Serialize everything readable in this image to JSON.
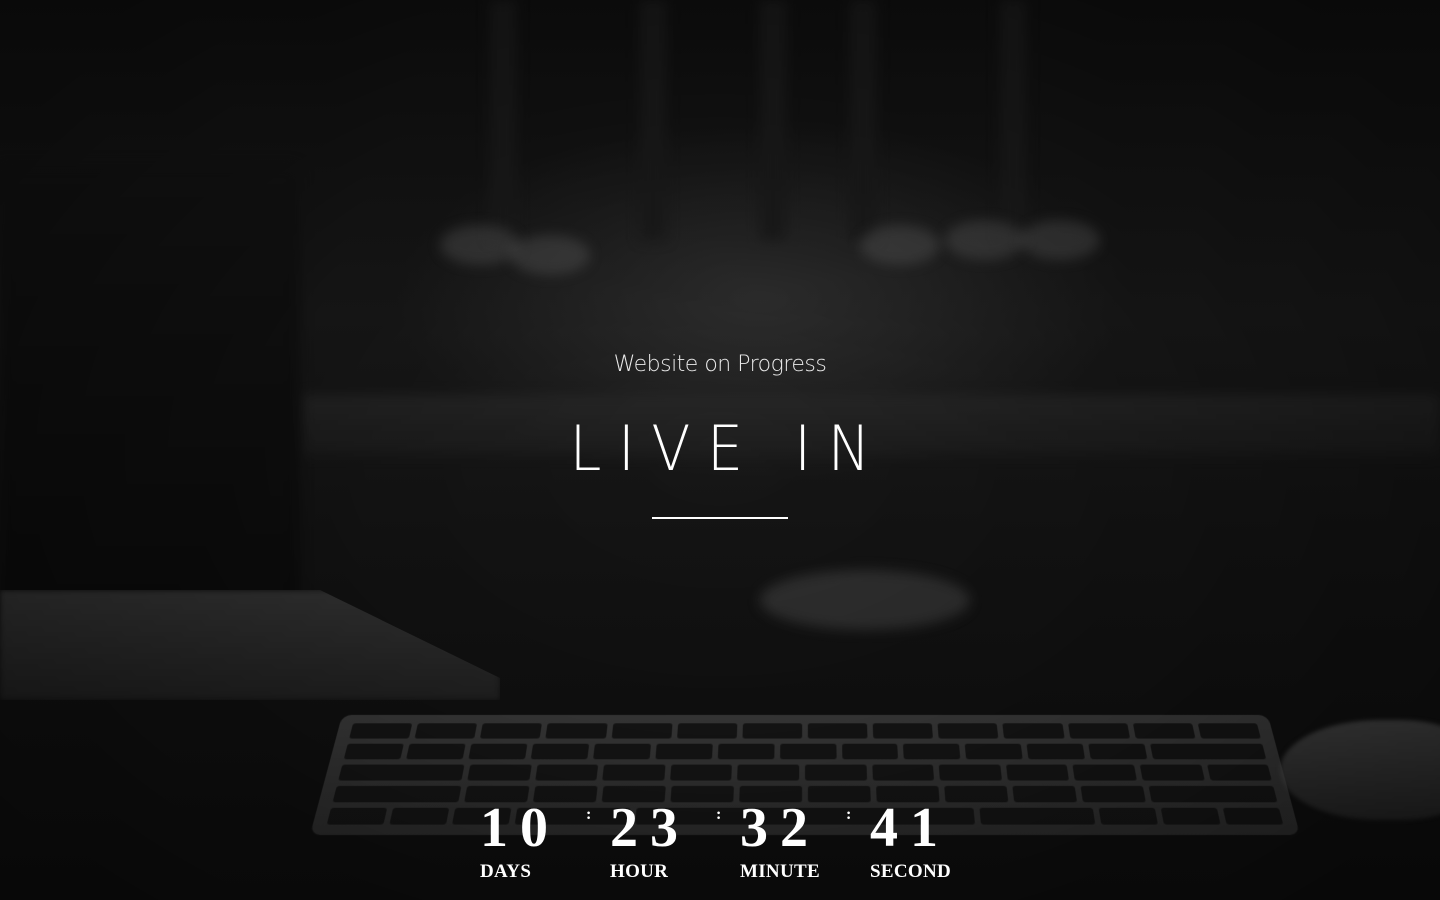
{
  "page": {
    "subtitle": "Website on Progress",
    "headline": "LIVE IN"
  },
  "countdown": {
    "days": {
      "value": "10",
      "label": "DAYS"
    },
    "hours": {
      "value": "23",
      "label": "HOUR"
    },
    "minutes": {
      "value": "32",
      "label": "MINUTE"
    },
    "seconds": {
      "value": "41",
      "label": "SECOND"
    },
    "separator": ":"
  },
  "colors": {
    "text": "#ffffff",
    "background": "#141414"
  }
}
